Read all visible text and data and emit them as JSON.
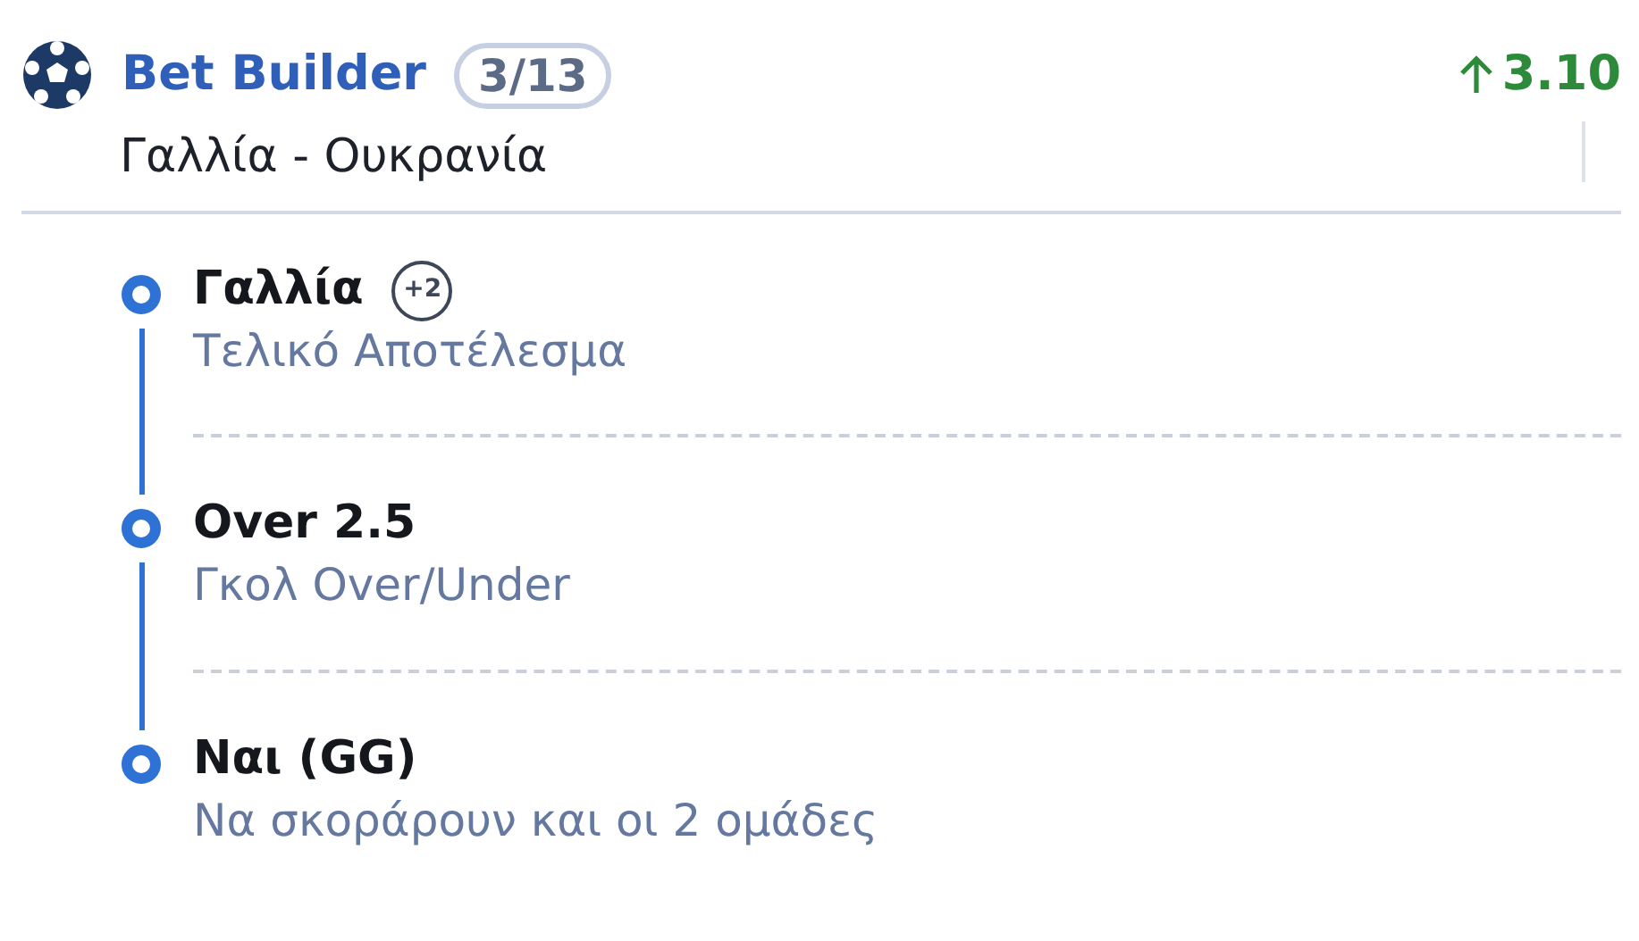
{
  "header": {
    "title": "Bet Builder",
    "count": "3/13",
    "odds": "3.10",
    "odds_rising": true,
    "match": "Γαλλία - Ουκρανία"
  },
  "selections": [
    {
      "pick": "Γαλλία",
      "extra": "+2",
      "market": "Τελικό Αποτέλεσμα"
    },
    {
      "pick": "Over 2.5",
      "market": "Γκολ Over/Under"
    },
    {
      "pick": "Ναι (GG)",
      "market": "Να σκοράρουν και οι 2 ομάδες"
    }
  ]
}
